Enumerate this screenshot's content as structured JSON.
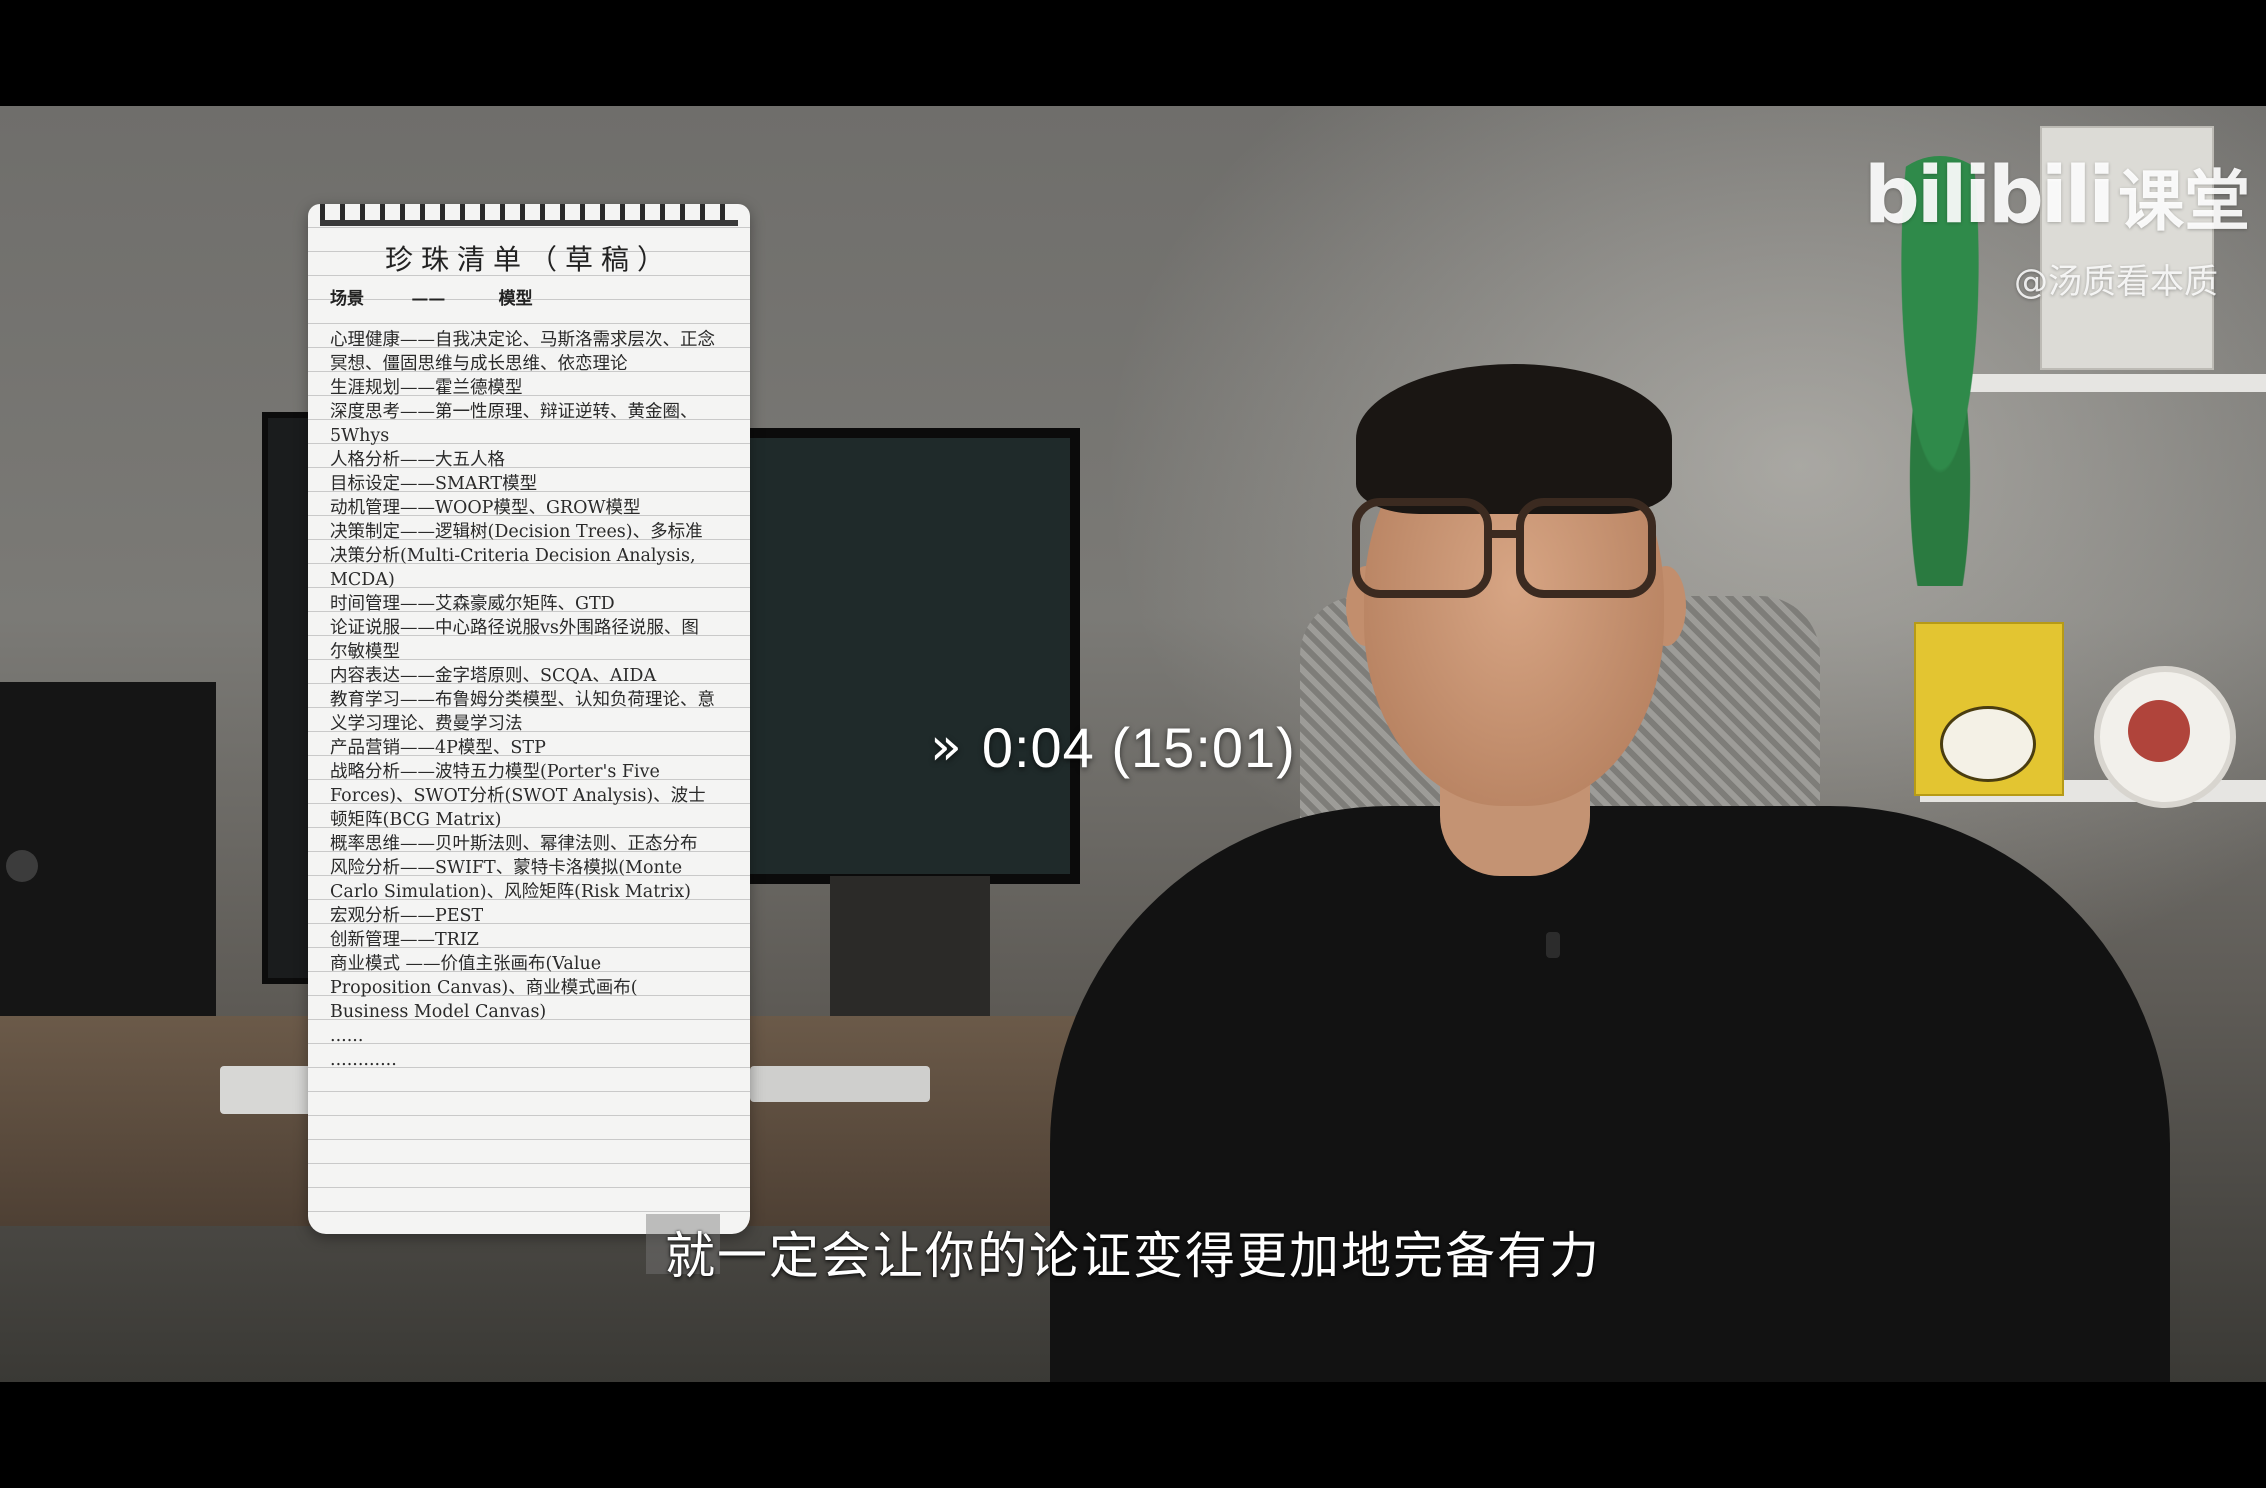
{
  "logo": {
    "brand": "bilibili",
    "sub": "课堂"
  },
  "watermark": "@汤质看本质",
  "notepad": {
    "title": "珍珠清单（草稿）",
    "header_col1": "场景",
    "header_sep": "——",
    "header_col2": "模型",
    "lines": [
      "心理健康——自我决定论、马斯洛需求层次、正念",
      "冥想、僵固思维与成长思维、依恋理论",
      "生涯规划——霍兰德模型",
      "深度思考——第一性原理、辩证逆转、黄金圈、",
      "5Whys",
      "人格分析——大五人格",
      "目标设定——SMART模型",
      "动机管理——WOOP模型、GROW模型",
      "决策制定——逻辑树(Decision Trees)、多标准",
      "决策分析(Multi-Criteria Decision Analysis,",
      "MCDA)",
      "时间管理——艾森豪威尔矩阵、GTD",
      "论证说服——中心路径说服vs外围路径说服、图",
      "尔敏模型",
      "内容表达——金字塔原则、SCQA、AIDA",
      "教育学习——布鲁姆分类模型、认知负荷理论、意",
      "义学习理论、费曼学习法",
      "产品营销——4P模型、STP",
      "战略分析——波特五力模型(Porter's Five",
      "Forces)、SWOT分析(SWOT Analysis)、波士",
      "顿矩阵(BCG Matrix)",
      "概率思维——贝叶斯法则、幂律法则、正态分布",
      "风险分析——SWIFT、蒙特卡洛模拟(Monte",
      "Carlo Simulation)、风险矩阵(Risk Matrix)",
      "宏观分析——PEST",
      "创新管理——TRIZ",
      "商业模式 ——价值主张画布(Value",
      "Proposition Canvas)、商业模式画布(",
      "Business Model Canvas)",
      "......",
      "............"
    ]
  },
  "seek": {
    "icon": "fast-forward-icon",
    "glyph": "»",
    "time": "0:04 (15:01)"
  },
  "subtitle": "就一定会让你的论证变得更加地完备有力"
}
